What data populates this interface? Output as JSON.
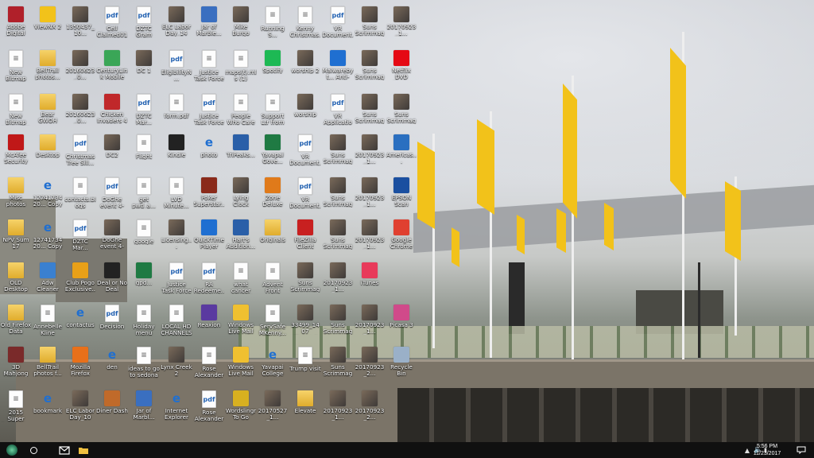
{
  "desktop_icons": [
    {
      "label": "Adobe Digital Editions 3.0",
      "icon": "adobe-de-icon",
      "kind": "app",
      "color": "#b0202a"
    },
    {
      "label": "ViewNX 2",
      "icon": "nikon-viewnx-icon",
      "kind": "app",
      "color": "#f2c21a"
    },
    {
      "label": "1350437_10...",
      "icon": "image-icon",
      "kind": "photo"
    },
    {
      "label": "Cell Claimed01",
      "icon": "pdf-icon",
      "kind": "pdf"
    },
    {
      "label": "DZTC Gram register form",
      "icon": "pdf-icon",
      "kind": "pdf"
    },
    {
      "label": "ELC Labor Day_14",
      "icon": "image-icon",
      "kind": "photo"
    },
    {
      "label": "Jar of Marble...",
      "icon": "game-icon",
      "kind": "app",
      "color": "#3a6fc0"
    },
    {
      "label": "Mike Burgo",
      "icon": "image-icon",
      "kind": "photo"
    },
    {
      "label": "Running S...",
      "icon": "document-icon",
      "kind": "doc"
    },
    {
      "label": "Kenny Christmas...",
      "icon": "document-icon",
      "kind": "doc"
    },
    {
      "label": "VR Document...",
      "icon": "pdf-icon",
      "kind": "pdf"
    },
    {
      "label": "Suns Scrimmage...",
      "icon": "image-icon",
      "kind": "photo"
    },
    {
      "label": "20170923_1...",
      "icon": "image-icon",
      "kind": "photo"
    },
    {
      "label": "New Bitmap Image",
      "icon": "bitmap-icon",
      "kind": "doc"
    },
    {
      "label": "BellTrail photos...",
      "icon": "folder-icon",
      "kind": "folder"
    },
    {
      "label": "20160623_0...",
      "icon": "image-icon",
      "kind": "photo"
    },
    {
      "label": "CenturyLink Mobile W...",
      "icon": "app-icon",
      "kind": "app",
      "color": "#3aa657"
    },
    {
      "label": "DC 1",
      "icon": "image-icon",
      "kind": "photo"
    },
    {
      "label": "EligibilityN...",
      "icon": "pdf-icon",
      "kind": "pdf"
    },
    {
      "label": "Justice Task Force",
      "icon": "document-icon",
      "kind": "doc"
    },
    {
      "label": "maps(t).mls (1)",
      "icon": "document-icon",
      "kind": "doc"
    },
    {
      "label": "Spotify",
      "icon": "spotify-icon",
      "kind": "app",
      "color": "#1db954"
    },
    {
      "label": "worship 2",
      "icon": "image-icon",
      "kind": "photo"
    },
    {
      "label": "Malwarebyt... Anti-Malware",
      "icon": "malwarebytes-icon",
      "kind": "app",
      "color": "#1f6fd1"
    },
    {
      "label": "Suns Scrimmage...",
      "icon": "image-icon",
      "kind": "photo"
    },
    {
      "label": "Netflix DVD Queue",
      "icon": "netflix-icon",
      "kind": "app",
      "color": "#e50914"
    },
    {
      "label": "New Bitmap Image (2)",
      "icon": "bitmap-icon",
      "kind": "doc"
    },
    {
      "label": "Bear GWOH",
      "icon": "folder-icon",
      "kind": "folder"
    },
    {
      "label": "20160623_0...",
      "icon": "image-icon",
      "kind": "photo"
    },
    {
      "label": "Chicken Invaders 4 -...",
      "icon": "game-icon",
      "kind": "app",
      "color": "#c0282a"
    },
    {
      "label": "DZTC Mar...",
      "icon": "pdf-icon",
      "kind": "pdf"
    },
    {
      "label": "form.pdf",
      "icon": "document-icon",
      "kind": "doc"
    },
    {
      "label": "Justice Task Force",
      "icon": "pdf-icon",
      "kind": "pdf"
    },
    {
      "label": "People Who Care",
      "icon": "document-icon",
      "kind": "doc"
    },
    {
      "label": "Support Ltr from Com...",
      "icon": "document-icon",
      "kind": "doc"
    },
    {
      "label": "worship",
      "icon": "image-icon",
      "kind": "photo"
    },
    {
      "label": "VR Application",
      "icon": "pdf-icon",
      "kind": "pdf"
    },
    {
      "label": "Suns Scrimmage...",
      "icon": "image-icon",
      "kind": "photo"
    },
    {
      "label": "Suns Scrimmage...",
      "icon": "image-icon",
      "kind": "photo"
    },
    {
      "label": "McAfee Security Sc...",
      "icon": "mcafee-icon",
      "kind": "app",
      "color": "#c01818"
    },
    {
      "label": "Desktop",
      "icon": "folder-icon",
      "kind": "folder"
    },
    {
      "label": "Christmas Tree Sill...",
      "icon": "pdf-icon",
      "kind": "pdf"
    },
    {
      "label": "DC2",
      "icon": "image-icon",
      "kind": "photo"
    },
    {
      "label": "Flight",
      "icon": "document-icon",
      "kind": "doc"
    },
    {
      "label": "Kindle",
      "icon": "kindle-icon",
      "kind": "app",
      "color": "#222222"
    },
    {
      "label": "photo",
      "icon": "edge-icon",
      "kind": "edge"
    },
    {
      "label": "TriPeaks...",
      "icon": "solitaire-icon",
      "kind": "app",
      "color": "#2a5fa8"
    },
    {
      "label": "Yavapai Gove...",
      "icon": "excel-icon",
      "kind": "app",
      "color": "#1f7a43"
    },
    {
      "label": "VR Document...",
      "icon": "pdf-icon",
      "kind": "pdf"
    },
    {
      "label": "Suns Scrimmage...",
      "icon": "image-icon",
      "kind": "photo"
    },
    {
      "label": "20170923_1...",
      "icon": "image-icon",
      "kind": "photo"
    },
    {
      "label": "Americas...",
      "icon": "app-icon",
      "kind": "app",
      "color": "#2a6fc0"
    },
    {
      "label": "Misc photos",
      "icon": "folder-icon",
      "kind": "folder"
    },
    {
      "label": "1274173420... Copy",
      "icon": "edge-icon",
      "kind": "edge"
    },
    {
      "label": "contacts.blogs",
      "icon": "document-icon",
      "kind": "doc"
    },
    {
      "label": "DoGhe event 4-16-16",
      "icon": "pdf-icon",
      "kind": "pdf"
    },
    {
      "label": "get pwd_a...",
      "icon": "document-icon",
      "kind": "doc"
    },
    {
      "label": "LVD Minute...",
      "icon": "document-icon",
      "kind": "doc"
    },
    {
      "label": "Poker Superstar...",
      "icon": "poker-icon",
      "kind": "app",
      "color": "#8a2a1a"
    },
    {
      "label": "Lying Clock",
      "icon": "image-icon",
      "kind": "photo"
    },
    {
      "label": "Zone Deluxe",
      "icon": "game-icon",
      "kind": "app",
      "color": "#e07a1a"
    },
    {
      "label": "VR Document...",
      "icon": "pdf-icon",
      "kind": "pdf"
    },
    {
      "label": "Suns Scrimmage...",
      "icon": "image-icon",
      "kind": "photo"
    },
    {
      "label": "20170923_1...",
      "icon": "image-icon",
      "kind": "photo"
    },
    {
      "label": "EPSON Scan",
      "icon": "epson-icon",
      "kind": "app",
      "color": "#1a4fa0"
    },
    {
      "label": "NPV Sum 17",
      "icon": "folder-icon",
      "kind": "folder"
    },
    {
      "label": "1274173420... Copy",
      "icon": "edge-icon",
      "kind": "edge"
    },
    {
      "label": "DZTC Mar...",
      "icon": "pdf-icon",
      "kind": "pdf"
    },
    {
      "label": "DoGhe event 4-16-16",
      "icon": "image-icon",
      "kind": "photo"
    },
    {
      "label": "google",
      "icon": "amazon-icon",
      "kind": "doc"
    },
    {
      "label": "Licensing...",
      "icon": "image-icon",
      "kind": "photo"
    },
    {
      "label": "QuickTime Player",
      "icon": "quicktime-icon",
      "kind": "app",
      "color": "#1f6fd1"
    },
    {
      "label": "Hart's Addition...",
      "icon": "solitaire-icon",
      "kind": "app",
      "color": "#2a5fa8"
    },
    {
      "label": "Originals",
      "icon": "folder-icon",
      "kind": "folder"
    },
    {
      "label": "FileZilla Client",
      "icon": "filezilla-icon",
      "kind": "app",
      "color": "#c82020"
    },
    {
      "label": "Suns Scrimmage...",
      "icon": "image-icon",
      "kind": "photo"
    },
    {
      "label": "20170923_1...",
      "icon": "image-icon",
      "kind": "photo"
    },
    {
      "label": "Google Chrome",
      "icon": "chrome-icon",
      "kind": "app",
      "color": "#e04030"
    },
    {
      "label": "OLD Desktop",
      "icon": "folder-icon",
      "kind": "folder"
    },
    {
      "label": "Adw Cleaner",
      "icon": "adwcleaner-icon",
      "kind": "app",
      "color": "#3a80d0"
    },
    {
      "label": "Club Pogo Exclusive...",
      "icon": "pogo-icon",
      "kind": "app",
      "color": "#e8a018"
    },
    {
      "label": "Deal or No Deal",
      "icon": "deal-icon",
      "kind": "app",
      "color": "#222222"
    },
    {
      "label": "gpd...",
      "icon": "excel-icon",
      "kind": "app",
      "color": "#1f7a43"
    },
    {
      "label": "Justice Task Force",
      "icon": "pdf-icon",
      "kind": "pdf"
    },
    {
      "label": "RA Redeeme...",
      "icon": "pdf-icon",
      "kind": "pdf"
    },
    {
      "label": "what cancer cannot do",
      "icon": "document-icon",
      "kind": "doc"
    },
    {
      "label": "Advent Front",
      "icon": "document-icon",
      "kind": "doc"
    },
    {
      "label": "Suns Scrimmage...",
      "icon": "image-icon",
      "kind": "photo"
    },
    {
      "label": "20170923_1...",
      "icon": "image-icon",
      "kind": "photo"
    },
    {
      "label": "iTunes",
      "icon": "itunes-icon",
      "kind": "app",
      "color": "#e83a5a"
    },
    {
      "label": "Old Firefox Data",
      "icon": "folder-icon",
      "kind": "folder"
    },
    {
      "label": "Annebelle Kline",
      "icon": "document-icon",
      "kind": "doc"
    },
    {
      "label": "contactus",
      "icon": "edge-icon",
      "kind": "edge"
    },
    {
      "label": "Decision",
      "icon": "pdf-icon",
      "kind": "pdf"
    },
    {
      "label": "Holiday menu",
      "icon": "document-icon",
      "kind": "doc"
    },
    {
      "label": "LOCAL HD CHANNELS",
      "icon": "document-icon",
      "kind": "doc"
    },
    {
      "label": "Reaxion",
      "icon": "game-icon",
      "kind": "app",
      "color": "#5a3aa0"
    },
    {
      "label": "Windows Live Mail",
      "icon": "mail-icon",
      "kind": "app",
      "color": "#f0c030"
    },
    {
      "label": "ServSafe MKenny...",
      "icon": "document-icon",
      "kind": "doc"
    },
    {
      "label": "33499_1407 Shortcut",
      "icon": "image-icon",
      "kind": "photo"
    },
    {
      "label": "Suns Scrimmage...",
      "icon": "image-icon",
      "kind": "photo"
    },
    {
      "label": "20170923_1...",
      "icon": "image-icon",
      "kind": "photo"
    },
    {
      "label": "Picasa 3",
      "icon": "picasa-icon",
      "kind": "app",
      "color": "#d04a8a"
    },
    {
      "label": "3D Mahjong Deluxe",
      "icon": "mahjong-icon",
      "kind": "app",
      "color": "#7a2a2a"
    },
    {
      "label": "BellTrail photos f...",
      "icon": "folder-icon",
      "kind": "folder"
    },
    {
      "label": "Mozilla Firefox",
      "icon": "firefox-icon",
      "kind": "app",
      "color": "#e8701a"
    },
    {
      "label": "den",
      "icon": "edge-icon",
      "kind": "edge"
    },
    {
      "label": "ideas to go to sedona so far",
      "icon": "document-icon",
      "kind": "doc"
    },
    {
      "label": "Lynx Creek 2",
      "icon": "image-icon",
      "kind": "photo"
    },
    {
      "label": "Rose Alexander r...",
      "icon": "document-icon",
      "kind": "doc"
    },
    {
      "label": "Windows Live Mail",
      "icon": "mail-icon",
      "kind": "app",
      "color": "#f0c030"
    },
    {
      "label": "Yavapai College Per...",
      "icon": "edge-icon",
      "kind": "edge"
    },
    {
      "label": "Trump visit",
      "icon": "document-icon",
      "kind": "doc"
    },
    {
      "label": "Suns Scrimmage...",
      "icon": "image-icon",
      "kind": "photo"
    },
    {
      "label": "20170923_2...",
      "icon": "image-icon",
      "kind": "photo"
    },
    {
      "label": "Recycle Bin",
      "icon": "recycle-bin-icon",
      "kind": "app",
      "color": "#9ab0c8"
    },
    {
      "label": "2015 Super Bowl LCI...",
      "icon": "document-icon",
      "kind": "doc"
    },
    {
      "label": "bookmark",
      "icon": "edge-icon",
      "kind": "edge"
    },
    {
      "label": "ELC Labor Day_10",
      "icon": "image-icon",
      "kind": "photo"
    },
    {
      "label": "Diner Dash",
      "icon": "game-icon",
      "kind": "app",
      "color": "#c06a2a"
    },
    {
      "label": "Jar of Marbl...",
      "icon": "game-icon",
      "kind": "app",
      "color": "#3a6fc0"
    },
    {
      "label": "Internet Explorer",
      "icon": "ie-icon",
      "kind": "edge"
    },
    {
      "label": "Rose Alexander r...",
      "icon": "pdf-icon",
      "kind": "pdf"
    },
    {
      "label": "Wordslingr To Go",
      "icon": "word-game-icon",
      "kind": "app",
      "color": "#d8b020"
    },
    {
      "label": "20170527_1...",
      "icon": "image-icon",
      "kind": "photo"
    },
    {
      "label": "Elevate",
      "icon": "folder-icon",
      "kind": "folder"
    },
    {
      "label": "20170923_1...",
      "icon": "image-icon",
      "kind": "photo"
    },
    {
      "label": "20170923_2...",
      "icon": "image-icon",
      "kind": "photo"
    }
  ],
  "taskbar": {
    "start_icon": "windows-start-icon",
    "search_icon": "search-circle-icon",
    "pinned": [
      {
        "name": "mail-taskbar",
        "icon": "mail-envelope-icon"
      },
      {
        "name": "file-explorer-taskbar",
        "icon": "folder-icon"
      }
    ],
    "tray_icons": [
      "chevron-up-icon",
      "volume-icon",
      "network-icon"
    ],
    "time": "5:56 PM",
    "date": "11/23/2017",
    "notification_icon": "action-center-icon"
  },
  "colors": {
    "taskbar_bg": "#101010",
    "label_text": "#ffffff",
    "flag": "#f2c21a"
  }
}
